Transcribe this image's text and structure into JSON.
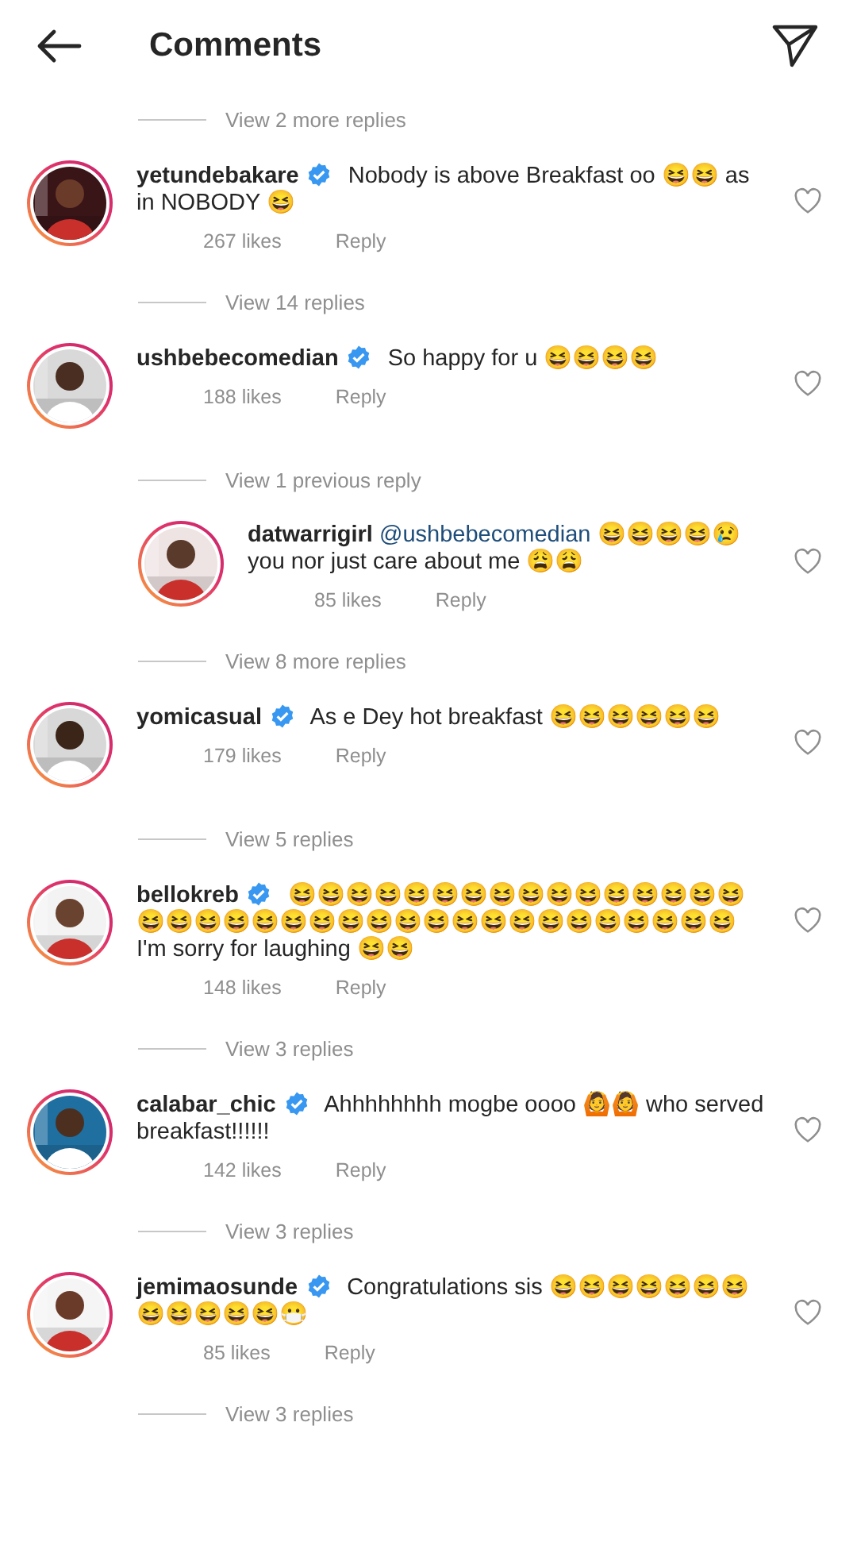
{
  "header": {
    "title": "Comments"
  },
  "items": [
    {
      "kind": "view_replies",
      "text": "View 2 more replies"
    },
    {
      "kind": "comment",
      "username": "yetundebakare",
      "verified": true,
      "text": "Nobody is above Breakfast oo 😆😆 as in NOBODY 😆",
      "likes": "267 likes",
      "reply": "Reply"
    },
    {
      "kind": "view_replies",
      "text": "View 14 replies"
    },
    {
      "kind": "comment",
      "username": "ushbebecomedian",
      "verified": true,
      "text": "So happy for u 😆😆😆😆",
      "likes": "188 likes",
      "reply": "Reply"
    },
    {
      "kind": "view_replies",
      "text": "View 1 previous reply"
    },
    {
      "kind": "reply",
      "username": "datwarrigirl",
      "verified": false,
      "mention": "@ushbebecomedian",
      "text": "😆😆😆😆😢 you nor just care about me 😩😩",
      "likes": "85 likes",
      "reply": "Reply"
    },
    {
      "kind": "view_replies",
      "text": "View 8 more replies"
    },
    {
      "kind": "comment",
      "username": "yomicasual",
      "verified": true,
      "text": "As e Dey hot breakfast 😆😆😆😆😆😆",
      "likes": "179 likes",
      "reply": "Reply"
    },
    {
      "kind": "view_replies",
      "text": "View 5 replies"
    },
    {
      "kind": "comment",
      "username": "bellokreb",
      "verified": true,
      "text": " 😆😆😆😆😆😆😆😆😆😆😆😆😆😆😆😆😆😆😆😆😆😆😆😆😆😆😆😆😆😆😆😆😆😆😆😆😆 I'm sorry for laughing 😆😆",
      "likes": "148 likes",
      "reply": "Reply"
    },
    {
      "kind": "view_replies",
      "text": "View 3 replies"
    },
    {
      "kind": "comment",
      "username": "calabar_chic",
      "verified": true,
      "text": "Ahhhhhhhh mogbe oooo 🙆🙆 who served breakfast!!!!!!",
      "likes": "142 likes",
      "reply": "Reply"
    },
    {
      "kind": "view_replies",
      "text": "View 3 replies"
    },
    {
      "kind": "comment",
      "username": "jemimaosunde",
      "verified": true,
      "text": "Congratulations sis 😆😆😆😆😆😆😆😆😆😆😆😆😷",
      "likes": "85 likes",
      "reply": "Reply"
    },
    {
      "kind": "view_replies",
      "text": "View 3 replies"
    }
  ]
}
